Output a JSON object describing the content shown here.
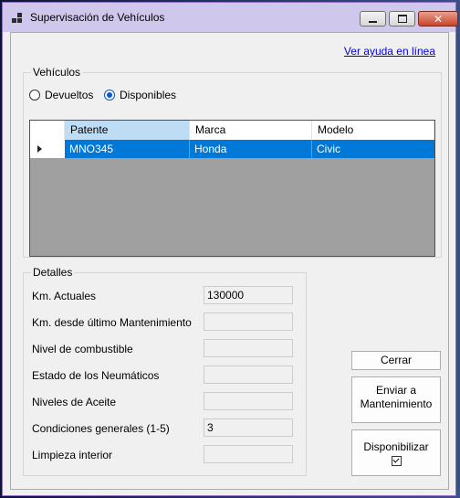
{
  "window": {
    "title": "Supervisación de Vehículos"
  },
  "help_link": "Ver ayuda en línea",
  "vehicles_group": {
    "label": "Vehículos",
    "radios": [
      {
        "label": "Devueltos",
        "checked": false
      },
      {
        "label": "Disponibles",
        "checked": true
      }
    ],
    "grid": {
      "columns": [
        "Patente",
        "Marca",
        "Modelo"
      ],
      "rows": [
        {
          "patente": "MNO345",
          "marca": "Honda",
          "modelo": "Civic",
          "selected": true
        }
      ]
    }
  },
  "details_group": {
    "label": "Detalles",
    "fields": [
      {
        "label": "Km. Actuales",
        "value": "130000"
      },
      {
        "label": "Km. desde último Mantenimiento",
        "value": ""
      },
      {
        "label": "Nivel de combustible",
        "value": ""
      },
      {
        "label": "Estado de los Neumáticos",
        "value": ""
      },
      {
        "label": "Niveles de Aceite",
        "value": ""
      },
      {
        "label": "Condiciones generales (1-5)",
        "value": "3"
      },
      {
        "label": "Limpieza interior",
        "value": ""
      }
    ]
  },
  "buttons": {
    "close": "Cerrar",
    "send_maintenance_line1": "Enviar a",
    "send_maintenance_line2": "Mantenimiento",
    "make_available": "Disponibilizar"
  },
  "colors": {
    "selection": "#0078d7",
    "title_bar": "#cfc8ec",
    "link": "#0000ee"
  }
}
